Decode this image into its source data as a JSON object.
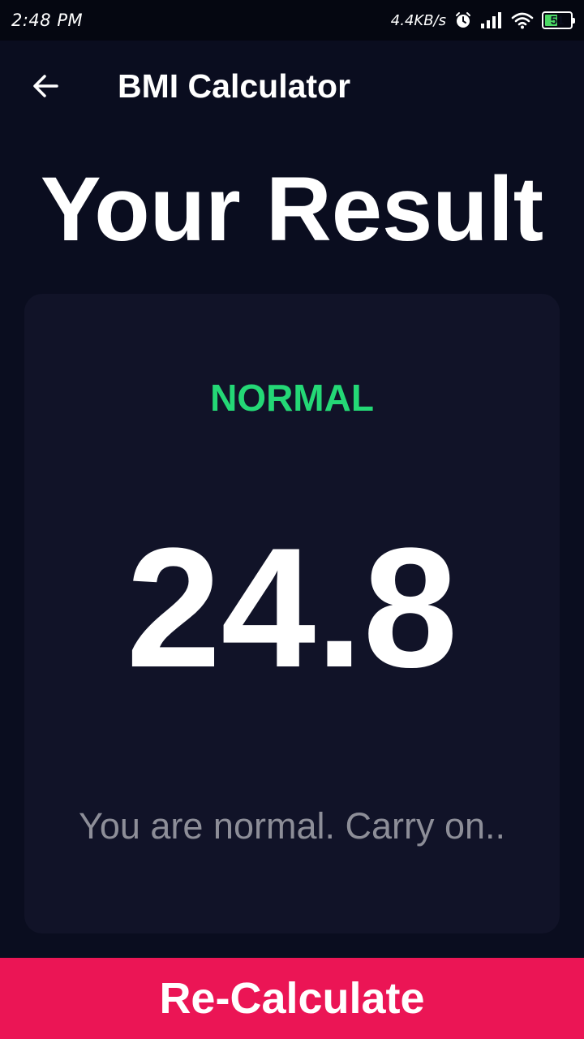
{
  "status_bar": {
    "time": "2:48 PM",
    "network_speed": "4.4KB/s",
    "battery_level": "51",
    "battery_fraction": 0.51,
    "icons": [
      "alarm-icon",
      "signal-icon",
      "wifi-icon",
      "battery-icon"
    ]
  },
  "app_bar": {
    "back_icon": "arrow-left-icon",
    "title": "BMI Calculator"
  },
  "page": {
    "title": "Your Result"
  },
  "result": {
    "status": "NORMAL",
    "bmi": "24.8",
    "message": "You are normal. Carry on.."
  },
  "actions": {
    "recalculate_label": "Re-Calculate"
  },
  "colors": {
    "background": "#0a0d1f",
    "card": "#111328",
    "status_green": "#24d876",
    "accent": "#eb1555",
    "muted_text": "#8d8e98"
  }
}
